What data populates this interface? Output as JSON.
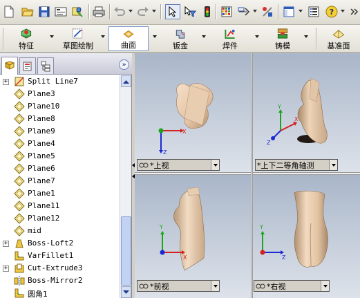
{
  "toolbar": {
    "new_icon": "new-document-icon",
    "open_icon": "open-folder-icon",
    "save_icon": "save-icon",
    "print_icon": "print-icon",
    "undo_icon": "undo-icon",
    "redo_icon": "redo-icon",
    "select_icon": "select-pointer-icon",
    "rebuild_icon": "traffic-light-icon",
    "help_icon": "help-icon"
  },
  "command_manager": {
    "tabs": [
      {
        "label": "特征",
        "icon": "features-icon"
      },
      {
        "label": "草图绘制",
        "icon": "sketch-icon"
      },
      {
        "label": "曲面",
        "icon": "surfaces-icon"
      },
      {
        "label": "钣金",
        "icon": "sheet-metal-icon"
      },
      {
        "label": "焊件",
        "icon": "weldments-icon"
      },
      {
        "label": "铸模",
        "icon": "mold-tools-icon"
      },
      {
        "label": "基准面",
        "icon": "reference-plane-icon"
      }
    ],
    "active": "曲面"
  },
  "feature_tree": {
    "items": [
      {
        "label": "Split Line7",
        "icon": "split-line-icon",
        "expandable": true
      },
      {
        "label": "Plane3",
        "icon": "plane-icon",
        "expandable": false
      },
      {
        "label": "Plane10",
        "icon": "plane-icon",
        "expandable": false
      },
      {
        "label": "Plane8",
        "icon": "plane-icon",
        "expandable": false
      },
      {
        "label": "Plane9",
        "icon": "plane-icon",
        "expandable": false
      },
      {
        "label": "Plane4",
        "icon": "plane-icon",
        "expandable": false
      },
      {
        "label": "Plane5",
        "icon": "plane-icon",
        "expandable": false
      },
      {
        "label": "Plane6",
        "icon": "plane-icon",
        "expandable": false
      },
      {
        "label": "Plane7",
        "icon": "plane-icon",
        "expandable": false
      },
      {
        "label": "Plane1",
        "icon": "plane-icon",
        "expandable": false
      },
      {
        "label": "Plane11",
        "icon": "plane-icon",
        "expandable": false
      },
      {
        "label": "Plane12",
        "icon": "plane-icon",
        "expandable": false
      },
      {
        "label": "mid",
        "icon": "plane-icon",
        "expandable": false
      },
      {
        "label": "Boss-Loft2",
        "icon": "loft-icon",
        "expandable": true
      },
      {
        "label": "VarFillet1",
        "icon": "fillet-icon",
        "expandable": false
      },
      {
        "label": "Cut-Extrude3",
        "icon": "cut-extrude-icon",
        "expandable": true
      },
      {
        "label": "Boss-Mirror2",
        "icon": "mirror-icon",
        "expandable": false
      },
      {
        "label": "圆角1",
        "icon": "fillet-icon",
        "expandable": false
      }
    ]
  },
  "viewports": {
    "top_left": {
      "label": "*上视"
    },
    "top_right": {
      "label": "*上下二等角轴测"
    },
    "bottom_left": {
      "label": "*前视"
    },
    "bottom_right": {
      "label": "*右视"
    }
  },
  "colors": {
    "model": "#e8c9aa",
    "axis_x": "#d42020",
    "axis_y": "#1aa51a",
    "axis_z": "#1a2ad4"
  }
}
